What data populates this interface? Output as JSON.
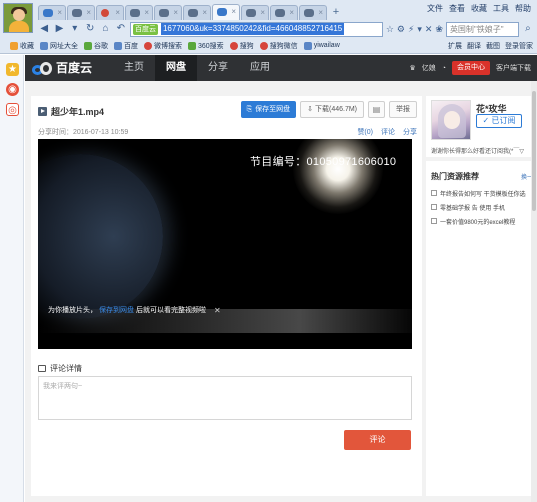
{
  "browser": {
    "tabs_count_note": "",
    "menus": [
      "文件",
      "查看",
      "收藏",
      "工具",
      "帮助"
    ],
    "address": {
      "secure_label": "百度云",
      "url_text": "1677060&uk=3374850242&fid=466048852716415"
    },
    "search_placeholder": "英国制\"铁娘子\"",
    "favorites": [
      {
        "label": "收藏",
        "icon": "star-icon"
      },
      {
        "label": "网址大全",
        "icon": "home-icon"
      },
      {
        "label": "谷歌",
        "icon": "google-icon"
      },
      {
        "label": "百度",
        "icon": "baidu-icon"
      },
      {
        "label": "微博搜索",
        "icon": "weibo-icon"
      },
      {
        "label": "360搜索",
        "icon": "360-icon"
      },
      {
        "label": "搜狗",
        "icon": "sogou-icon"
      },
      {
        "label": "搜狗微信",
        "icon": "wechat-icon"
      },
      {
        "label": "yiwailaw",
        "icon": "page-icon"
      }
    ],
    "fav_right": [
      "扩展",
      "翻译",
      "截图",
      "登录管家"
    ]
  },
  "site": {
    "logo_text": "百度云",
    "nav": [
      "主页",
      "网盘",
      "分享",
      "应用"
    ],
    "nav_active": "网盘",
    "user": "亿娘",
    "vip_button": "会员中心",
    "client_download": "客户端下载"
  },
  "file": {
    "name": "超少年1.mp4",
    "save_button": "保存至网盘",
    "download_button": "下载(446.7M)",
    "report_button": "举报",
    "share_time": "分享时间：2016-07-13 10:59",
    "likes": "赞(0)",
    "comment_link": "评论",
    "share_link": "分享",
    "video_id_text": "节目编号：01050971606010",
    "notice_prefix": "为你播放片头，",
    "notice_link": "保存到网盘",
    "notice_suffix": "后就可以看完整视频啦",
    "notice_close": "✕"
  },
  "comments": {
    "title": "评论详情",
    "placeholder": "我来评两句~",
    "submit": "评论"
  },
  "uploader": {
    "name": "花*玫华",
    "follow_button": "已订阅",
    "description": "谢谢你长得那么好看还订阅我(*￣▽"
  },
  "hot": {
    "title": "热门资源推荐",
    "more": "换一",
    "items": [
      "年终报告如何写 干货模板任你选",
      "零基础学报 告 使用 手机",
      "一套价值9800元的excel教程"
    ]
  },
  "colors": {
    "accent": "#2c7bd6",
    "nav_bg": "#2f3134",
    "comment_button": "#e2563b",
    "vip_button": "#d9322a"
  }
}
